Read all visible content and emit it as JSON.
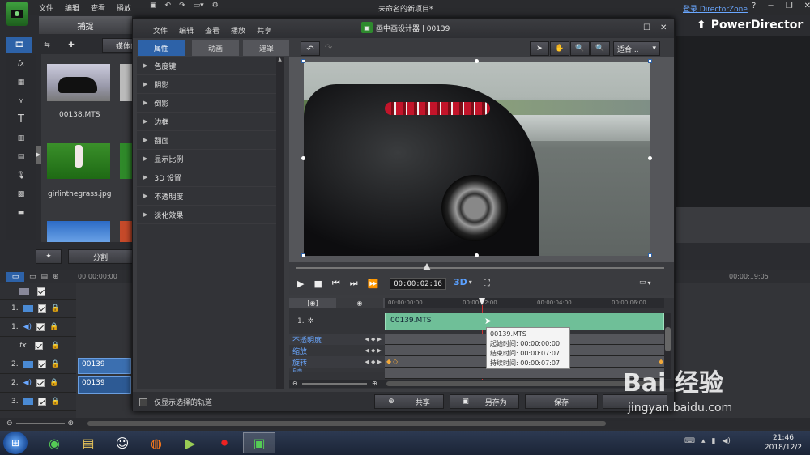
{
  "main_window": {
    "menu": [
      "文件",
      "编辑",
      "查看",
      "播放"
    ],
    "title": "未命名的新项目*",
    "login_link": "登录 DirectorZone",
    "help": "?",
    "brand": "PowerDirector",
    "capture_tab": "捕捉",
    "media_content_btn": "媒体内容",
    "split_btn": "分割",
    "media_items": [
      {
        "name": "00138.MTS"
      },
      {
        "name": "girlinthegrass.jpg"
      }
    ],
    "timeline": {
      "start_time": "00:00:00:00",
      "end_time": "00:00:19:05",
      "tracks": [
        "1.",
        "1.",
        "",
        "2.",
        "2.",
        "3."
      ],
      "clips": [
        "00139",
        "00139"
      ]
    }
  },
  "dialog": {
    "title": "画中画设计器 | 00139",
    "menu": [
      "文件",
      "编辑",
      "查看",
      "播放",
      "共享"
    ],
    "tabs": [
      "属性",
      "动画",
      "遮罩"
    ],
    "properties": [
      "色度键",
      "阴影",
      "倒影",
      "边框",
      "翻面",
      "显示比例",
      "3D 设置",
      "不透明度",
      "淡化效果"
    ],
    "fit_label": "适合...",
    "timecode": "00:00:02:16",
    "mode_3d": "3D",
    "keyframe_ruler": [
      "00:00:00:00",
      "00:00:02:00",
      "00:00:04:00",
      "00:00:06:00"
    ],
    "clip_track_label": "1.",
    "clip_name": "00139.MTS",
    "keyframe_rows": [
      "不透明度",
      "缩放",
      "旋转",
      "自由"
    ],
    "tooltip": {
      "name": "00139.MTS",
      "start": "起始时间: 00:00:00:00",
      "end": "结束时间: 00:00:07:07",
      "duration": "持续时间: 00:00:07:07"
    },
    "only_selected_label": "仅显示选择的轨道",
    "share_btn": "共享",
    "save_as_btn": "另存为",
    "save_btn": "保存"
  },
  "watermark": {
    "text": "Bai 经验",
    "url": "jingyan.baidu.com"
  },
  "taskbar": {
    "time": "21:46",
    "date": "2018/12/2"
  }
}
